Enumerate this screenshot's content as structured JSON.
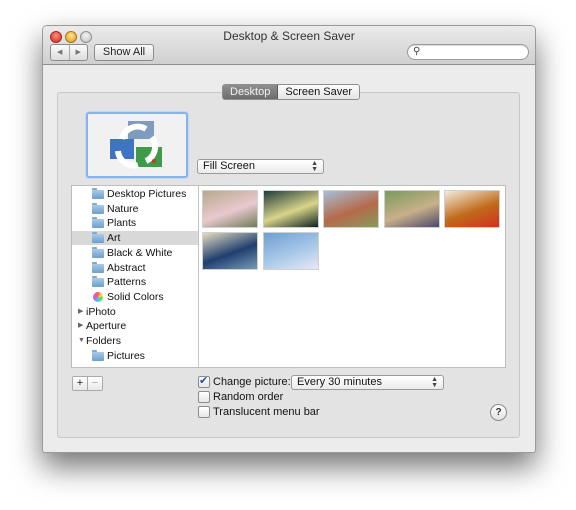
{
  "window": {
    "title": "Desktop & Screen Saver",
    "back_icon": "back-arrow-icon",
    "forward_icon": "forward-arrow-icon",
    "show_all_label": "Show All",
    "search": {
      "value": "",
      "placeholder": "",
      "icon": "magnifier-icon"
    }
  },
  "tabs": [
    {
      "label": "Desktop",
      "active": true
    },
    {
      "label": "Screen Saver",
      "active": false
    }
  ],
  "preview": {
    "icon": "rotating-pictures-icon"
  },
  "fill_mode": {
    "selected": "Fill Screen"
  },
  "sidebar": {
    "items": [
      {
        "label": "Desktop Pictures",
        "icon": "folder-icon",
        "selected": false
      },
      {
        "label": "Nature",
        "icon": "folder-icon",
        "selected": false
      },
      {
        "label": "Plants",
        "icon": "folder-icon",
        "selected": false
      },
      {
        "label": "Art",
        "icon": "folder-icon",
        "selected": true
      },
      {
        "label": "Black & White",
        "icon": "folder-icon",
        "selected": false
      },
      {
        "label": "Abstract",
        "icon": "folder-icon",
        "selected": false
      },
      {
        "label": "Patterns",
        "icon": "folder-icon",
        "selected": false
      },
      {
        "label": "Solid Colors",
        "icon": "color-wheel-icon",
        "selected": false
      },
      {
        "label": "iPhoto",
        "icon": "disclosure-collapsed-icon",
        "selected": false
      },
      {
        "label": "Aperture",
        "icon": "disclosure-collapsed-icon",
        "selected": false
      },
      {
        "label": "Folders",
        "icon": "disclosure-expanded-icon",
        "selected": false
      },
      {
        "label": "Pictures",
        "icon": "folder-icon",
        "selected": false
      }
    ]
  },
  "thumbnails": [
    {
      "name": "degas-dancer",
      "colors": [
        "#b7a88a",
        "#e9c9cf",
        "#6f7c5a"
      ]
    },
    {
      "name": "hopper-nighthawks",
      "colors": [
        "#1f3b3a",
        "#d8d48a",
        "#0f2222"
      ]
    },
    {
      "name": "monet-poppies",
      "colors": [
        "#a8c0d8",
        "#b56a4a",
        "#889a5c"
      ]
    },
    {
      "name": "seurat-grande-jatte",
      "colors": [
        "#7a9a5a",
        "#c8b08a",
        "#4a4a6a"
      ]
    },
    {
      "name": "malevich-suprematism",
      "colors": [
        "#f2ece0",
        "#c06a1a",
        "#d43020"
      ]
    },
    {
      "name": "hokusai-great-wave",
      "colors": [
        "#e6dcc0",
        "#1f3f6f",
        "#7a9ab8"
      ]
    },
    {
      "name": "monet-water-lilies",
      "colors": [
        "#6f9fd0",
        "#a8c8e8",
        "#e8e8f8"
      ]
    }
  ],
  "bottom": {
    "add_label": "+",
    "remove_label": "−",
    "change_picture": {
      "label": "Change picture:",
      "checked": true
    },
    "interval": {
      "selected": "Every 30 minutes"
    },
    "random_order": {
      "label": "Random order",
      "checked": false
    },
    "translucent_menu_bar": {
      "label": "Translucent menu bar",
      "checked": false
    },
    "help_label": "?"
  }
}
